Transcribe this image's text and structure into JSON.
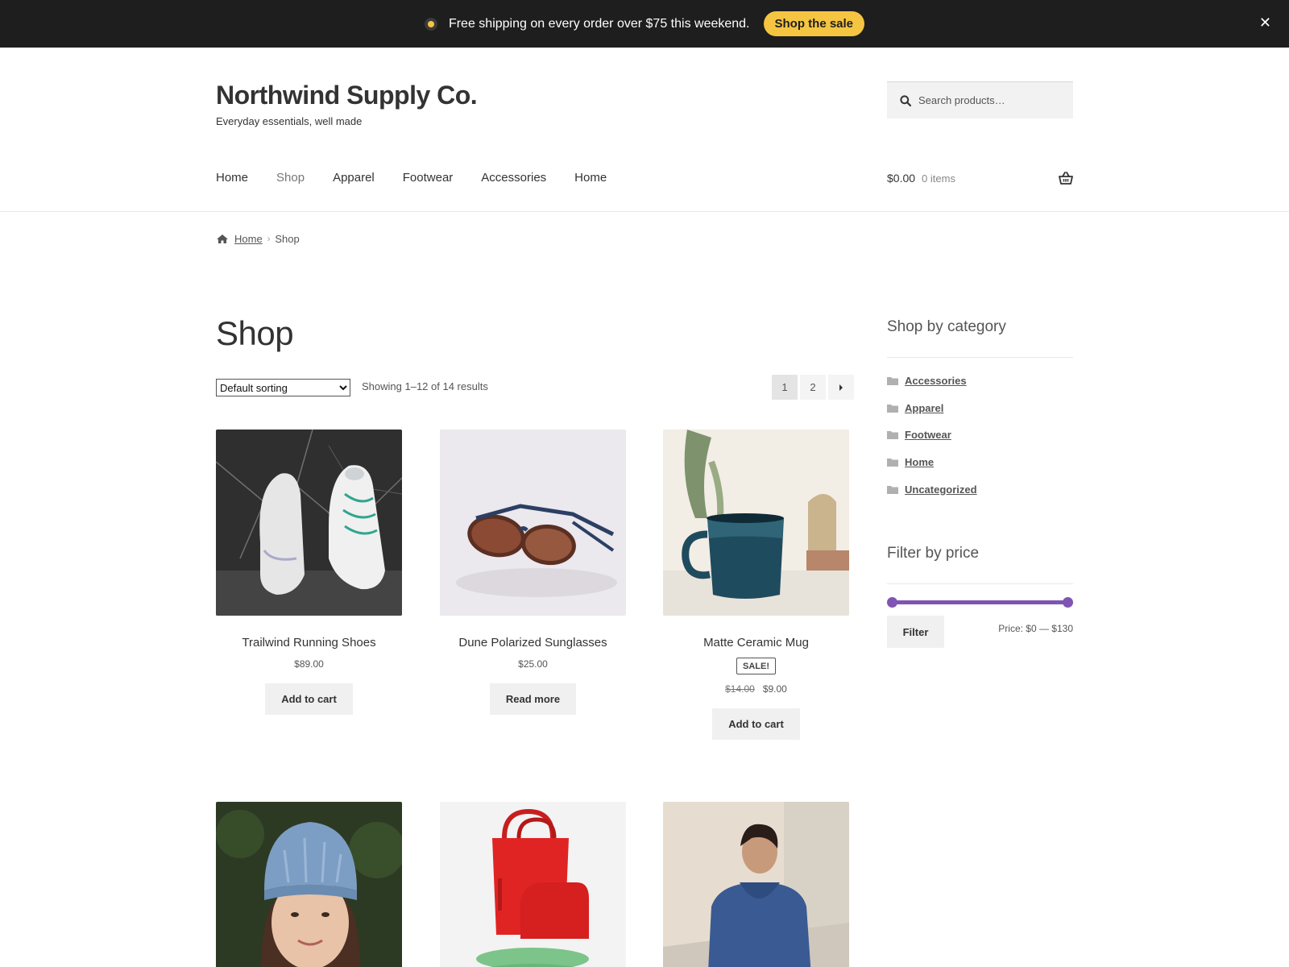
{
  "promo": {
    "text": "Free shipping on every order over $75 this weekend.",
    "button": "Shop the sale",
    "close": "✕",
    "accent": "#f5c542"
  },
  "site": {
    "title": "Northwind Supply Co.",
    "tagline": "Everyday essentials, well made"
  },
  "search": {
    "placeholder": "Search products…",
    "icon": "search-icon"
  },
  "nav": {
    "items": [
      "Home",
      "Shop",
      "Apparel",
      "Footwear",
      "Accessories",
      "Home"
    ],
    "active": "Shop"
  },
  "cart": {
    "total": "$0.00",
    "count": "0 items",
    "icon": "basket-icon"
  },
  "breadcrumb": {
    "home": "Home",
    "current": "Shop"
  },
  "main": {
    "title": "Shop",
    "sorting": "Default sorting",
    "result_count": "Showing 1–12 of 14 results",
    "pagination": {
      "pages": [
        "1",
        "2"
      ],
      "current": "1",
      "next": "›"
    }
  },
  "products": [
    {
      "name": "Trailwind Running Shoes",
      "price": "$89.00",
      "button": "Add to cart"
    },
    {
      "name": "Dune Polarized Sunglasses",
      "price": "$25.00",
      "button": "Read more"
    },
    {
      "name": "Matte Ceramic Mug",
      "sale_badge": "SALE!",
      "old_price": "$14.00",
      "price": "$9.00",
      "button": "Add to cart"
    },
    {
      "name": "",
      "price": "",
      "button": ""
    },
    {
      "name": "",
      "price": "",
      "button": ""
    },
    {
      "name": "",
      "price": "",
      "button": ""
    }
  ],
  "sidebar": {
    "categories_title": "Shop by category",
    "categories": [
      "Accessories",
      "Apparel",
      "Footwear",
      "Home",
      "Uncategorized"
    ],
    "price_title": "Filter by price",
    "filter_button": "Filter",
    "price_range": "Price: $0 — $130",
    "slider_min": 0,
    "slider_max": 130,
    "slider_color": "#7f54b3"
  }
}
